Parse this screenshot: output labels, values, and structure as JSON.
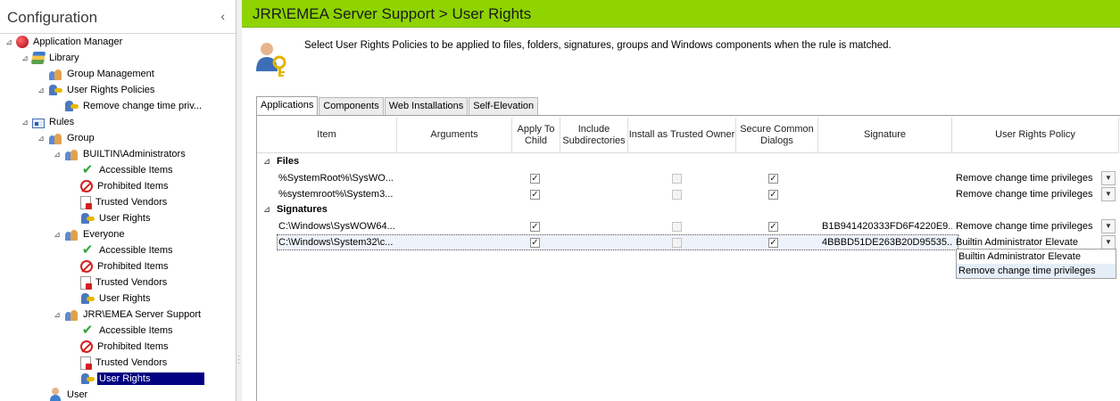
{
  "left_pane": {
    "title": "Configuration",
    "collapse_glyph": "‹",
    "tree": [
      {
        "label": "Application Manager",
        "icon": "app-manager-icon",
        "expander": "⊿"
      },
      {
        "label": "Library",
        "icon": "library-icon",
        "expander": "⊿"
      },
      {
        "label": "Group Management",
        "icon": "group-management-icon",
        "expander": ""
      },
      {
        "label": "User Rights Policies",
        "icon": "user-rights-policies-icon",
        "expander": "⊿"
      },
      {
        "label": "Remove change time priv...",
        "icon": "user-rights-policy-icon",
        "expander": ""
      },
      {
        "label": "Rules",
        "icon": "rules-icon",
        "expander": "⊿"
      },
      {
        "label": "Group",
        "icon": "group-icon",
        "expander": "⊿"
      },
      {
        "label": "BUILTIN\\Administrators",
        "icon": "group-icon",
        "expander": "⊿"
      },
      {
        "label": "Accessible Items",
        "icon": "check-icon",
        "expander": ""
      },
      {
        "label": "Prohibited Items",
        "icon": "prohibited-icon",
        "expander": ""
      },
      {
        "label": "Trusted Vendors",
        "icon": "trusted-vendors-icon",
        "expander": ""
      },
      {
        "label": "User Rights",
        "icon": "user-rights-icon",
        "expander": ""
      },
      {
        "label": "Everyone",
        "icon": "group-icon",
        "expander": "⊿"
      },
      {
        "label": "Accessible Items",
        "icon": "check-icon",
        "expander": ""
      },
      {
        "label": "Prohibited Items",
        "icon": "prohibited-icon",
        "expander": ""
      },
      {
        "label": "Trusted Vendors",
        "icon": "trusted-vendors-icon",
        "expander": ""
      },
      {
        "label": "User Rights",
        "icon": "user-rights-icon",
        "expander": ""
      },
      {
        "label": "JRR\\EMEA Server Support",
        "icon": "group-icon",
        "expander": "⊿"
      },
      {
        "label": "Accessible Items",
        "icon": "check-icon",
        "expander": ""
      },
      {
        "label": "Prohibited Items",
        "icon": "prohibited-icon",
        "expander": ""
      },
      {
        "label": "Trusted Vendors",
        "icon": "trusted-vendors-icon",
        "expander": ""
      },
      {
        "label": "User Rights",
        "icon": "user-rights-icon",
        "expander": "",
        "selected": true
      },
      {
        "label": "User",
        "icon": "user-icon",
        "expander": ""
      }
    ]
  },
  "header": {
    "title": "JRR\\EMEA Server Support > User Rights",
    "bar_color": "#8fd400"
  },
  "description": "Select User Rights Policies to be applied to files, folders, signatures, groups and Windows components when the rule is matched.",
  "tabs": [
    {
      "label": "Applications",
      "active": true
    },
    {
      "label": "Components",
      "active": false
    },
    {
      "label": "Web Installations",
      "active": false
    },
    {
      "label": "Self-Elevation",
      "active": false
    }
  ],
  "grid": {
    "columns": [
      "Item",
      "Arguments",
      "Apply To Child",
      "Include Subdirectories",
      "Install as Trusted Owner",
      "Secure Common Dialogs",
      "Signature",
      "User Rights Policy"
    ],
    "section_expander": "⊿",
    "sections": [
      {
        "name": "Files",
        "rows": [
          {
            "item": "%SystemRoot%\\SysWO...",
            "arguments": "",
            "apply_to_child": true,
            "include_subdirectories": null,
            "install_trusted_owner": false,
            "secure_common_dialogs": true,
            "signature": "",
            "policy": "Remove change time privileges"
          },
          {
            "item": "%systemroot%\\System3...",
            "arguments": "",
            "apply_to_child": true,
            "include_subdirectories": null,
            "install_trusted_owner": false,
            "secure_common_dialogs": true,
            "signature": "",
            "policy": "Remove change time privileges"
          }
        ]
      },
      {
        "name": "Signatures",
        "rows": [
          {
            "item": "C:\\Windows\\SysWOW64...",
            "arguments": "",
            "apply_to_child": true,
            "include_subdirectories": null,
            "install_trusted_owner": false,
            "secure_common_dialogs": true,
            "signature": "B1B941420333FD6F4220E9...",
            "policy": "Remove change time privileges"
          },
          {
            "item": "C:\\Windows\\System32\\c...",
            "arguments": "",
            "apply_to_child": true,
            "include_subdirectories": null,
            "install_trusted_owner": false,
            "secure_common_dialogs": true,
            "signature": "4BBBD51DE263B20D95535...",
            "policy": "Builtin Administrator Elevate",
            "selected": true
          }
        ]
      }
    ],
    "dropdown_options": [
      "Builtin Administrator Elevate",
      "Remove change time privileges"
    ],
    "dropdown_hover_index": 1
  }
}
